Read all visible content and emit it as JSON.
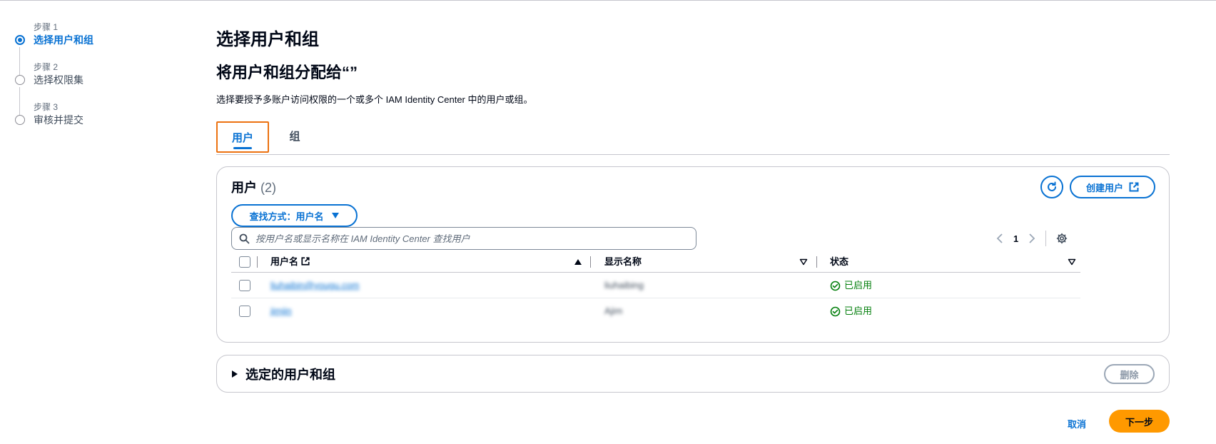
{
  "stepper": {
    "steps": [
      {
        "num": "步骤 1",
        "title": "选择用户和组"
      },
      {
        "num": "步骤 2",
        "title": "选择权限集"
      },
      {
        "num": "步骤 3",
        "title": "审核并提交"
      }
    ]
  },
  "page": {
    "title": "选择用户和组",
    "subtitle": "将用户和组分配给“”",
    "description": "选择要授予多账户访问权限的一个或多个 IAM Identity Center 中的用户或组。"
  },
  "tabs": [
    {
      "label": "用户"
    },
    {
      "label": "组"
    }
  ],
  "users_panel": {
    "title": "用户",
    "count": "(2)",
    "create_label": "创建用户",
    "filter_label": "查找方式：用户名",
    "search_placeholder": "按用户名或显示名称在 IAM Identity Center 查找用户",
    "page_number": "1",
    "columns": [
      "用户名",
      "显示名称",
      "状态"
    ],
    "rows": [
      {
        "username": "liuhaibin@yougu.com",
        "display_name": "liuhaibing",
        "status": "已启用"
      },
      {
        "username": "jimjin",
        "display_name": "Ajim",
        "status": "已启用"
      }
    ]
  },
  "selected_panel": {
    "title": "选定的用户和组",
    "remove_label": "删除"
  },
  "footer": {
    "cancel_label": "取消",
    "next_label": "下一步"
  },
  "colors": {
    "accent": "#0972d3",
    "primary_button": "#ff9900",
    "success": "#037f0c",
    "focus_outline": "#ec7211"
  }
}
